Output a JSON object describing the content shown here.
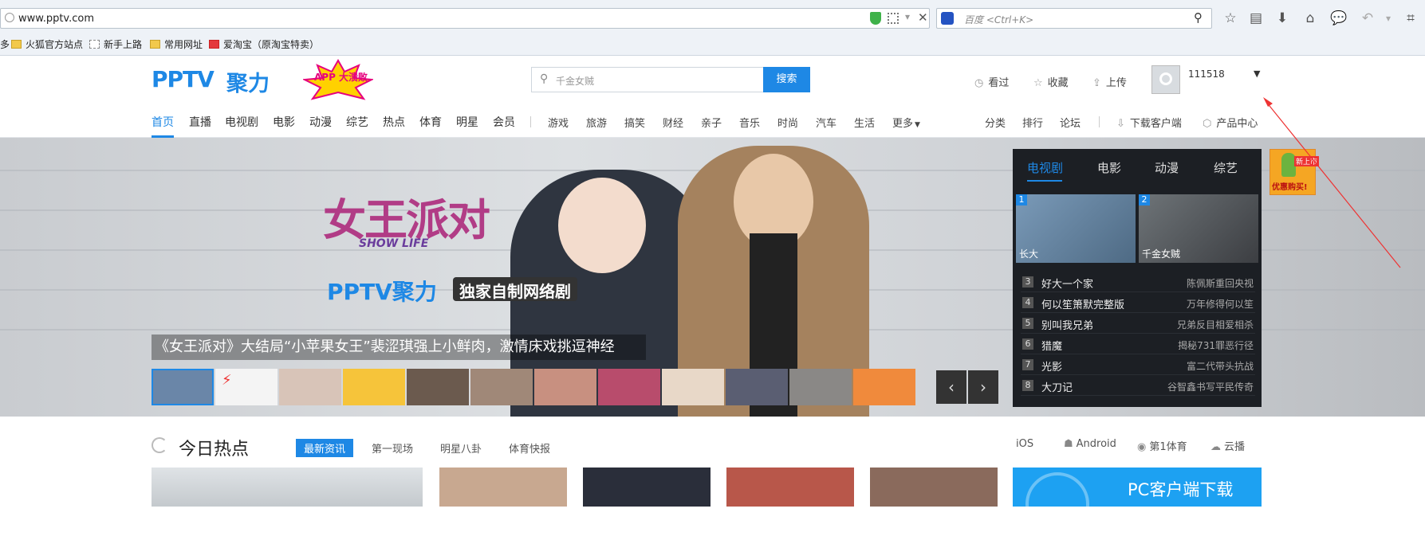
{
  "browser": {
    "url": "www.pptv.com",
    "search_placeholder": "百度 <Ctrl+K>"
  },
  "bookmarks": [
    {
      "label": "多",
      "icon": "none"
    },
    {
      "label": "火狐官方站点",
      "icon": "folder-icon"
    },
    {
      "label": "新手上路",
      "icon": "page-icon"
    },
    {
      "label": "常用网址",
      "icon": "folder-icon"
    },
    {
      "label": "爱淘宝（原淘宝特卖）",
      "icon": "taobao-icon"
    }
  ],
  "header": {
    "logo_text": "PPTV",
    "logo_sub": "聚力",
    "app_badge": "APP 大溃败",
    "search_placeholder": "千金女贼",
    "search_button": "搜索",
    "watched": "看过",
    "favorites": "收藏",
    "upload": "上传",
    "username": "111518"
  },
  "nav": {
    "primary": [
      "首页",
      "直播",
      "电视剧",
      "电影",
      "动漫",
      "综艺",
      "热点",
      "体育",
      "明星",
      "会员"
    ],
    "secondary": [
      "游戏",
      "旅游",
      "搞笑",
      "财经",
      "亲子",
      "音乐",
      "时尚",
      "汽车",
      "生活",
      "更多"
    ],
    "right": [
      "分类",
      "排行",
      "论坛",
      "下载客户端",
      "产品中心"
    ]
  },
  "banner": {
    "title_art": "女王派对",
    "title_art_sub": "SHOW LIFE",
    "brand_line": "PPTV聚力",
    "brand_tag": "独家自制网络剧",
    "caption": "《女王派对》大结局“小苹果女王”裴涩琪强上小鲜肉，激情床戏挑逗神经"
  },
  "panel": {
    "tabs": [
      "电视剧",
      "电影",
      "动漫",
      "综艺"
    ],
    "active_tab": "电视剧",
    "featured": [
      {
        "rank": "1",
        "title": "长大"
      },
      {
        "rank": "2",
        "title": "千金女贼"
      }
    ],
    "list": [
      {
        "rank": "3",
        "title": "好大一个家",
        "desc": "陈佩斯重回央视"
      },
      {
        "rank": "4",
        "title": "何以笙箫默完整版",
        "desc": "万年修得何以笙"
      },
      {
        "rank": "5",
        "title": "别叫我兄弟",
        "desc": "兄弟反目相爱相杀"
      },
      {
        "rank": "6",
        "title": "猎魔",
        "desc": "揭秘731罪恶行径"
      },
      {
        "rank": "7",
        "title": "光影",
        "desc": "富二代带头抗战"
      },
      {
        "rank": "8",
        "title": "大刀记",
        "desc": "谷智鑫书写平民传奇"
      }
    ]
  },
  "ad": {
    "badge": "新上市",
    "text": "优惠购买!"
  },
  "hot": {
    "title": "今日热点",
    "tabs": [
      "最新资讯",
      "第一现场",
      "明星八卦",
      "体育快报"
    ],
    "active_tab": "最新资讯",
    "platforms": [
      "iOS",
      "Android",
      "第1体育",
      "云播"
    ]
  },
  "pc_download": {
    "label": "PC客户端下载"
  },
  "colors": {
    "accent": "#1e88e5",
    "panel_bg": "#1c1f24"
  }
}
